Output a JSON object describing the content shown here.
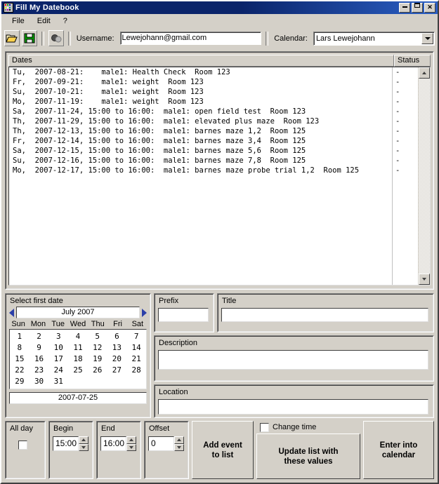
{
  "window": {
    "title": "Fill My Datebook",
    "icon": "app-grid-icon",
    "controls": {
      "minimize": "minimize",
      "maximize": "maximize",
      "close": "close"
    }
  },
  "menubar": {
    "items": [
      {
        "label": "File",
        "name": "menu-file"
      },
      {
        "label": "Edit",
        "name": "menu-edit"
      },
      {
        "label": "?",
        "name": "menu-help"
      }
    ]
  },
  "toolbar": {
    "buttons": [
      {
        "name": "open-folder-icon",
        "title": "Open"
      },
      {
        "name": "save-disk-icon",
        "title": "Save"
      },
      {
        "name": "globe-icon",
        "title": "Connect"
      }
    ],
    "username_label": "Username:",
    "username_value": "Lewejohann@gmail.com",
    "calendar_label": "Calendar:",
    "calendar_value": "Lars Lewejohann"
  },
  "list": {
    "col_dates": "Dates",
    "col_status": "Status",
    "rows": [
      {
        "text": "Tu,  2007-08-21:    male1: Health Check  Room 123",
        "status": "-"
      },
      {
        "text": "Fr,  2007-09-21:    male1: weight  Room 123",
        "status": "-"
      },
      {
        "text": "Su,  2007-10-21:    male1: weight  Room 123",
        "status": "-"
      },
      {
        "text": "Mo,  2007-11-19:    male1: weight  Room 123",
        "status": "-"
      },
      {
        "text": "Sa,  2007-11-24, 15:00 to 16:00:  male1: open field test  Room 123",
        "status": "-"
      },
      {
        "text": "Th,  2007-11-29, 15:00 to 16:00:  male1: elevated plus maze  Room 123",
        "status": "-"
      },
      {
        "text": "Th,  2007-12-13, 15:00 to 16:00:  male1: barnes maze 1,2  Room 125",
        "status": "-"
      },
      {
        "text": "Fr,  2007-12-14, 15:00 to 16:00:  male1: barnes maze 3,4  Room 125",
        "status": "-"
      },
      {
        "text": "Sa,  2007-12-15, 15:00 to 16:00:  male1: barnes maze 5,6  Room 125",
        "status": "-"
      },
      {
        "text": "Su,  2007-12-16, 15:00 to 16:00:  male1: barnes maze 7,8  Room 125",
        "status": "-"
      },
      {
        "text": "Mo,  2007-12-17, 15:00 to 16:00:  male1: barnes maze probe trial 1,2  Room 125",
        "status": "-"
      }
    ]
  },
  "calendar": {
    "group_title": "Select first date",
    "prev_icon": "chevron-left-icon",
    "next_icon": "chevron-right-icon",
    "month": "July 2007",
    "dow": [
      "Sun",
      "Mon",
      "Tue",
      "Wed",
      "Thu",
      "Fri",
      "Sat"
    ],
    "leading_blanks": 0,
    "days": [
      1,
      2,
      3,
      4,
      5,
      6,
      7,
      8,
      9,
      10,
      11,
      12,
      13,
      14,
      15,
      16,
      17,
      18,
      19,
      20,
      21,
      22,
      23,
      24,
      25,
      26,
      27,
      28,
      29,
      30,
      31
    ],
    "selected_date": "2007-07-25"
  },
  "fields": {
    "prefix_label": "Prefix",
    "prefix_value": "",
    "title_label": "Title",
    "title_value": "",
    "description_label": "Description",
    "description_value": "",
    "location_label": "Location",
    "location_value": ""
  },
  "bottom": {
    "allday_label": "All day",
    "allday_checked": false,
    "begin_label": "Begin",
    "begin_value": "15:00",
    "end_label": "End",
    "end_value": "16:00",
    "offset_label": "Offset",
    "offset_value": "0",
    "add_event_line1": "Add event",
    "add_event_line2": "to list",
    "change_time_label": "Change time",
    "change_time_checked": false,
    "update_line1": "Update list with",
    "update_line2": "these values",
    "enter_line1": "Enter into",
    "enter_line2": "calendar"
  },
  "colors": {
    "face": "#d4d0c8",
    "title_bar": "#0a246a",
    "title_text": "#ffffff",
    "field_bg": "#ffffff",
    "arrow_blue": "#2b3fa8"
  }
}
